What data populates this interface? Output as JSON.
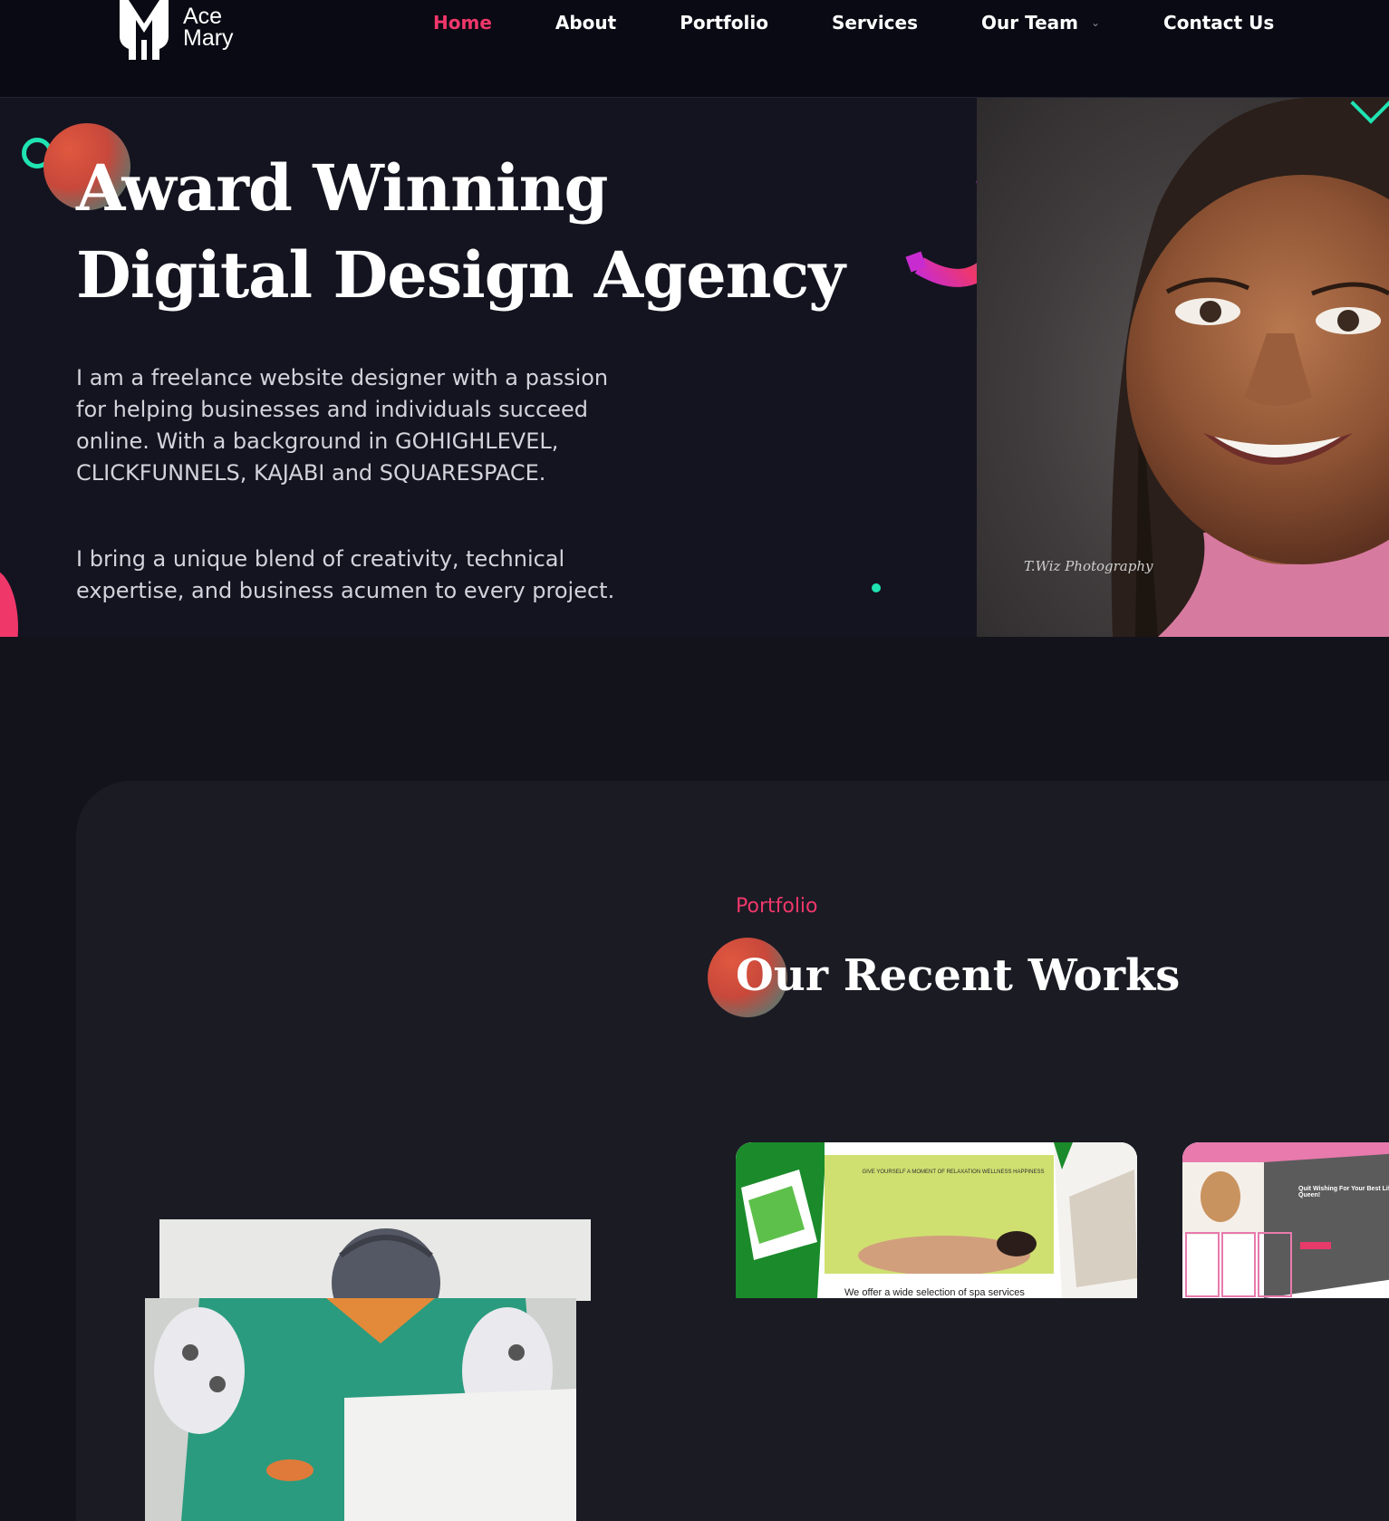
{
  "brand": {
    "name_line1": "Ace",
    "name_line2": "Mary",
    "accent_color": "#f0376a",
    "teal_color": "#20e3b2",
    "background_color": "#13131c"
  },
  "nav": {
    "items": [
      {
        "label": "Home",
        "active": true
      },
      {
        "label": "About",
        "active": false
      },
      {
        "label": "Portfolio",
        "active": false
      },
      {
        "label": "Services",
        "active": false
      },
      {
        "label": "Our Team",
        "active": false,
        "has_dropdown": true
      },
      {
        "label": "Contact Us",
        "active": false
      }
    ],
    "dropdown_icon": "chevron-down-icon"
  },
  "hero": {
    "title_line1": "Award Winning",
    "title_line2": "Digital Design Agency",
    "paragraph1": "I am a freelance website designer with a passion for helping businesses and individuals succeed online. With a background in GOHIGHLEVEL, CLICKFUNNELS, KAJABI and SQUARESPACE.",
    "paragraph2": "I bring a unique blend of creativity, technical expertise, and business acumen to every project.",
    "portrait_signature": "T.Wiz Photography"
  },
  "portfolio": {
    "eyebrow": "Portfolio",
    "title": "Our Recent Works",
    "thumbnails": [
      {
        "heading": "GIVE YOURSELF A MOMENT OF RELAXATION WELLNESS HAPPINESS",
        "caption": "We offer a wide selection of spa services"
      },
      {
        "heading": "Quit Wishing For Your Best Life Queen!"
      }
    ]
  }
}
